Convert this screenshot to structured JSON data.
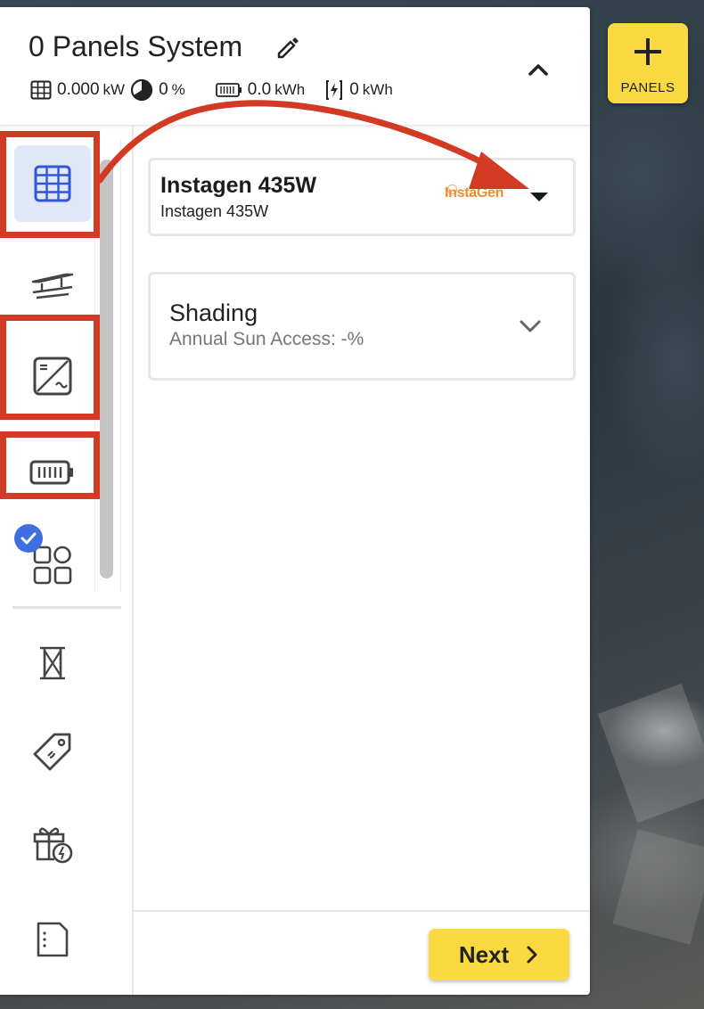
{
  "header": {
    "title": "0 Panels System",
    "stats": [
      {
        "icon": "solar-panel-icon",
        "value": "0.000",
        "unit": "kW"
      },
      {
        "icon": "offset-pie-icon",
        "value": "0",
        "unit": "%"
      },
      {
        "icon": "battery-small-icon",
        "value": "0.0",
        "unit": "kWh"
      },
      {
        "icon": "energy-bolt-icon",
        "value": "0",
        "unit": "kWh"
      }
    ]
  },
  "add_button": {
    "label": "PANELS"
  },
  "module": {
    "name": "Instagen 435W",
    "subtitle": "Instagen 435W",
    "brand": "InstaGen"
  },
  "shading": {
    "title": "Shading",
    "subtitle": "Annual Sun Access: -%"
  },
  "footer": {
    "next_label": "Next"
  },
  "sidebar": {
    "items": [
      {
        "icon": "solar-panel-grid-icon",
        "active": true
      },
      {
        "icon": "racking-icon"
      },
      {
        "icon": "inverter-icon"
      },
      {
        "icon": "battery-icon"
      },
      {
        "icon": "components-icon",
        "completed": true
      },
      {
        "icon": "structure-icon"
      },
      {
        "icon": "price-tag-icon"
      },
      {
        "icon": "incentives-gift-icon"
      },
      {
        "icon": "document-icon"
      }
    ]
  },
  "colors": {
    "accent_yellow": "#fada40",
    "active_blue": "#3355d6",
    "active_bg": "#dfe7f8",
    "annotation_red": "#d23a24",
    "brand_orange": "#f08a2e"
  }
}
